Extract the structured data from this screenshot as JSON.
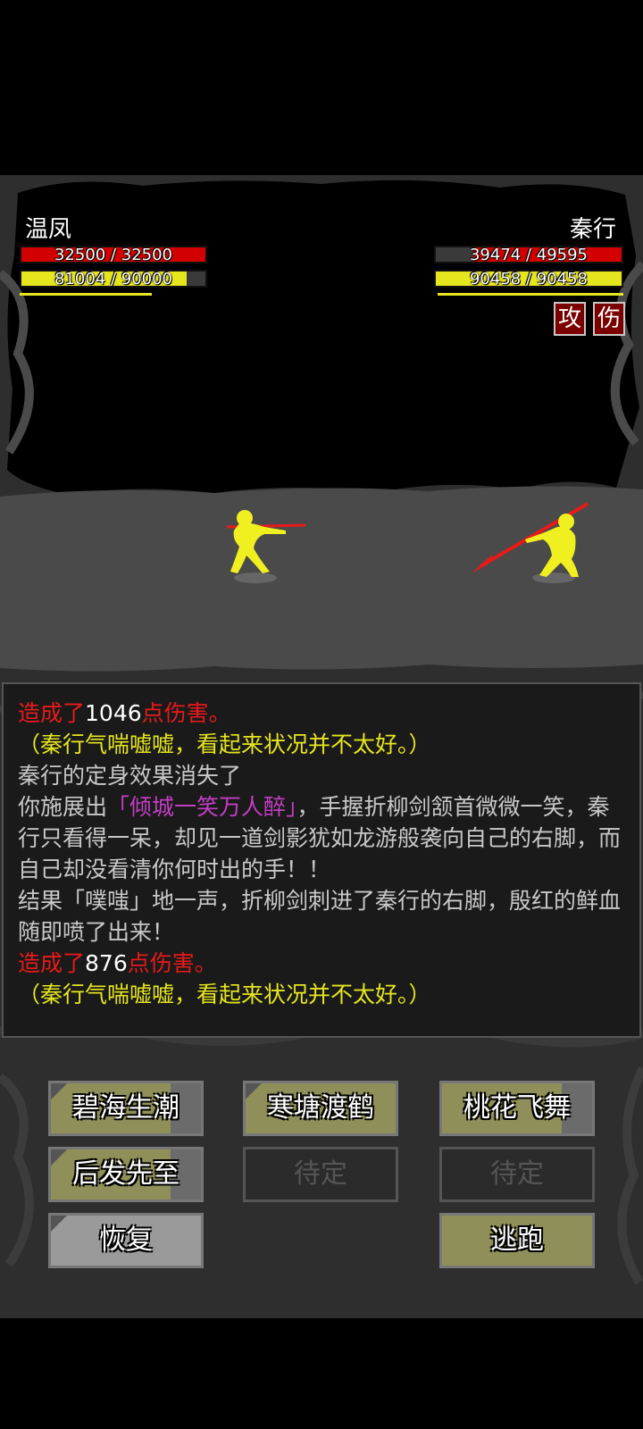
{
  "player": {
    "name": "温凤",
    "hp_text": "32500 / 32500",
    "hp_fraction": 1.0,
    "mp_text": "81004 / 90000",
    "mp_fraction": 0.9
  },
  "enemy": {
    "name": "秦行",
    "hp_text": "39474 / 49595",
    "hp_fraction": 0.796,
    "mp_text": "90458 / 90458",
    "mp_fraction": 1.0,
    "status_tags": [
      "攻",
      "伤"
    ]
  },
  "colors": {
    "hp": "#d20000",
    "mp": "#e6e61e",
    "damage": "#e81a1a",
    "highlight": "#e6e61e",
    "skill_name": "#c43ec4"
  },
  "log": {
    "line1_prefix": "造成了",
    "line1_value": "1046",
    "line1_suffix": "点伤害。",
    "line2": "（秦行气喘嘘嘘，看起来状况并不太好。）",
    "line3": "秦行的定身效果消失了",
    "line4_prefix": "你施展出",
    "line4_skill": "「倾城一笑万人醉」",
    "line4_rest": "，手握折柳剑颔首微微一笑，秦行只看得一呆，却见一道剑影犹如龙游般袭向自己的右脚，而自己却没看清你何时出的手！！",
    "line5": "结果「噗嗤」地一声，折柳剑刺进了秦行的右脚，殷红的鲜血随即喷了出来！",
    "line6_prefix": "造成了",
    "line6_value": "876",
    "line6_suffix": "点伤害。",
    "line7": "（秦行气喘嘘嘘，看起来状况并不太好。）"
  },
  "skills": {
    "btn1": "碧海生潮",
    "btn2": "寒塘渡鹤",
    "btn3": "桃花飞舞",
    "btn4": "后发先至",
    "btn5": "待定",
    "btn6": "待定",
    "recover": "恢复",
    "flee": "逃跑"
  }
}
